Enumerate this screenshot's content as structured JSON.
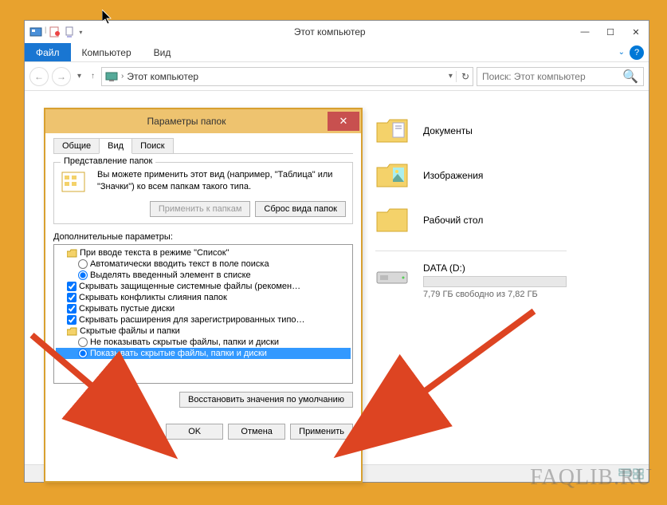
{
  "explorer": {
    "title": "Этот компьютер",
    "menu": {
      "file": "Файл",
      "computer": "Компьютер",
      "view": "Вид"
    },
    "address": "Этот компьютер",
    "search_placeholder": "Поиск: Этот компьютер",
    "folders": [
      {
        "label": "Документы"
      },
      {
        "label": "Изображения"
      },
      {
        "label": "Рабочий стол"
      }
    ],
    "drive": {
      "label": "DATA (D:)",
      "status": "7,79 ГБ свободно из 7,82 ГБ"
    }
  },
  "dialog": {
    "title": "Параметры папок",
    "tabs": {
      "general": "Общие",
      "view": "Вид",
      "search": "Поиск"
    },
    "group": {
      "title": "Представление папок",
      "desc": "Вы можете применить этот вид (например, \"Таблица\" или \"Значки\") ко всем папкам такого типа.",
      "apply_btn": "Применить к папкам",
      "reset_btn": "Сброс вида папок"
    },
    "adv_label": "Дополнительные параметры:",
    "tree": {
      "node0": "При вводе текста в режиме \"Список\"",
      "opt0a": "Автоматически вводить текст в поле поиска",
      "opt0b": "Выделять введенный элемент в списке",
      "chk1": "Скрывать защищенные системные файлы (рекомен…",
      "chk2": "Скрывать конфликты слияния папок",
      "chk3": "Скрывать пустые диски",
      "chk4": "Скрывать расширения для зарегистрированных типо…",
      "node1": "Скрытые файлы и папки",
      "opt1a": "Не показывать скрытые файлы, папки и диски",
      "opt1b": "Показывать скрытые файлы, папки и диски"
    },
    "restore": "Восстановить значения по умолчанию",
    "ok": "OK",
    "cancel": "Отмена",
    "apply": "Применить"
  },
  "watermark": "FAQLIB.RU"
}
